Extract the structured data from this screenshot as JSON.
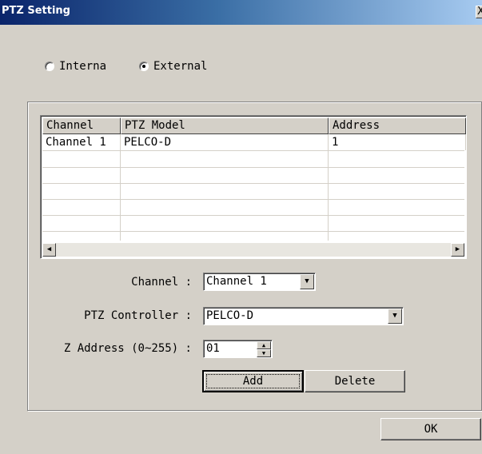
{
  "window": {
    "title": "PTZ Setting",
    "close_glyph": "X"
  },
  "mode": {
    "options": [
      {
        "label": "Interna",
        "checked": false
      },
      {
        "label": "External",
        "checked": true
      }
    ]
  },
  "table": {
    "columns": [
      "Channel",
      "PTZ Model",
      "Address"
    ],
    "rows": [
      [
        "Channel 1",
        "PELCO-D",
        "1"
      ]
    ]
  },
  "form": {
    "channel_label": "Channel :",
    "channel_value": "Channel 1",
    "controller_label": "PTZ Controller :",
    "controller_value": "PELCO-D",
    "address_label": "Z Address (0~255) :",
    "address_value": "01"
  },
  "buttons": {
    "add": "Add",
    "delete": "Delete",
    "ok": "OK"
  },
  "icons": {
    "scroll_left": "◀",
    "scroll_right": "▶",
    "dropdown": "▼",
    "spin_up": "▲",
    "spin_down": "▼"
  }
}
